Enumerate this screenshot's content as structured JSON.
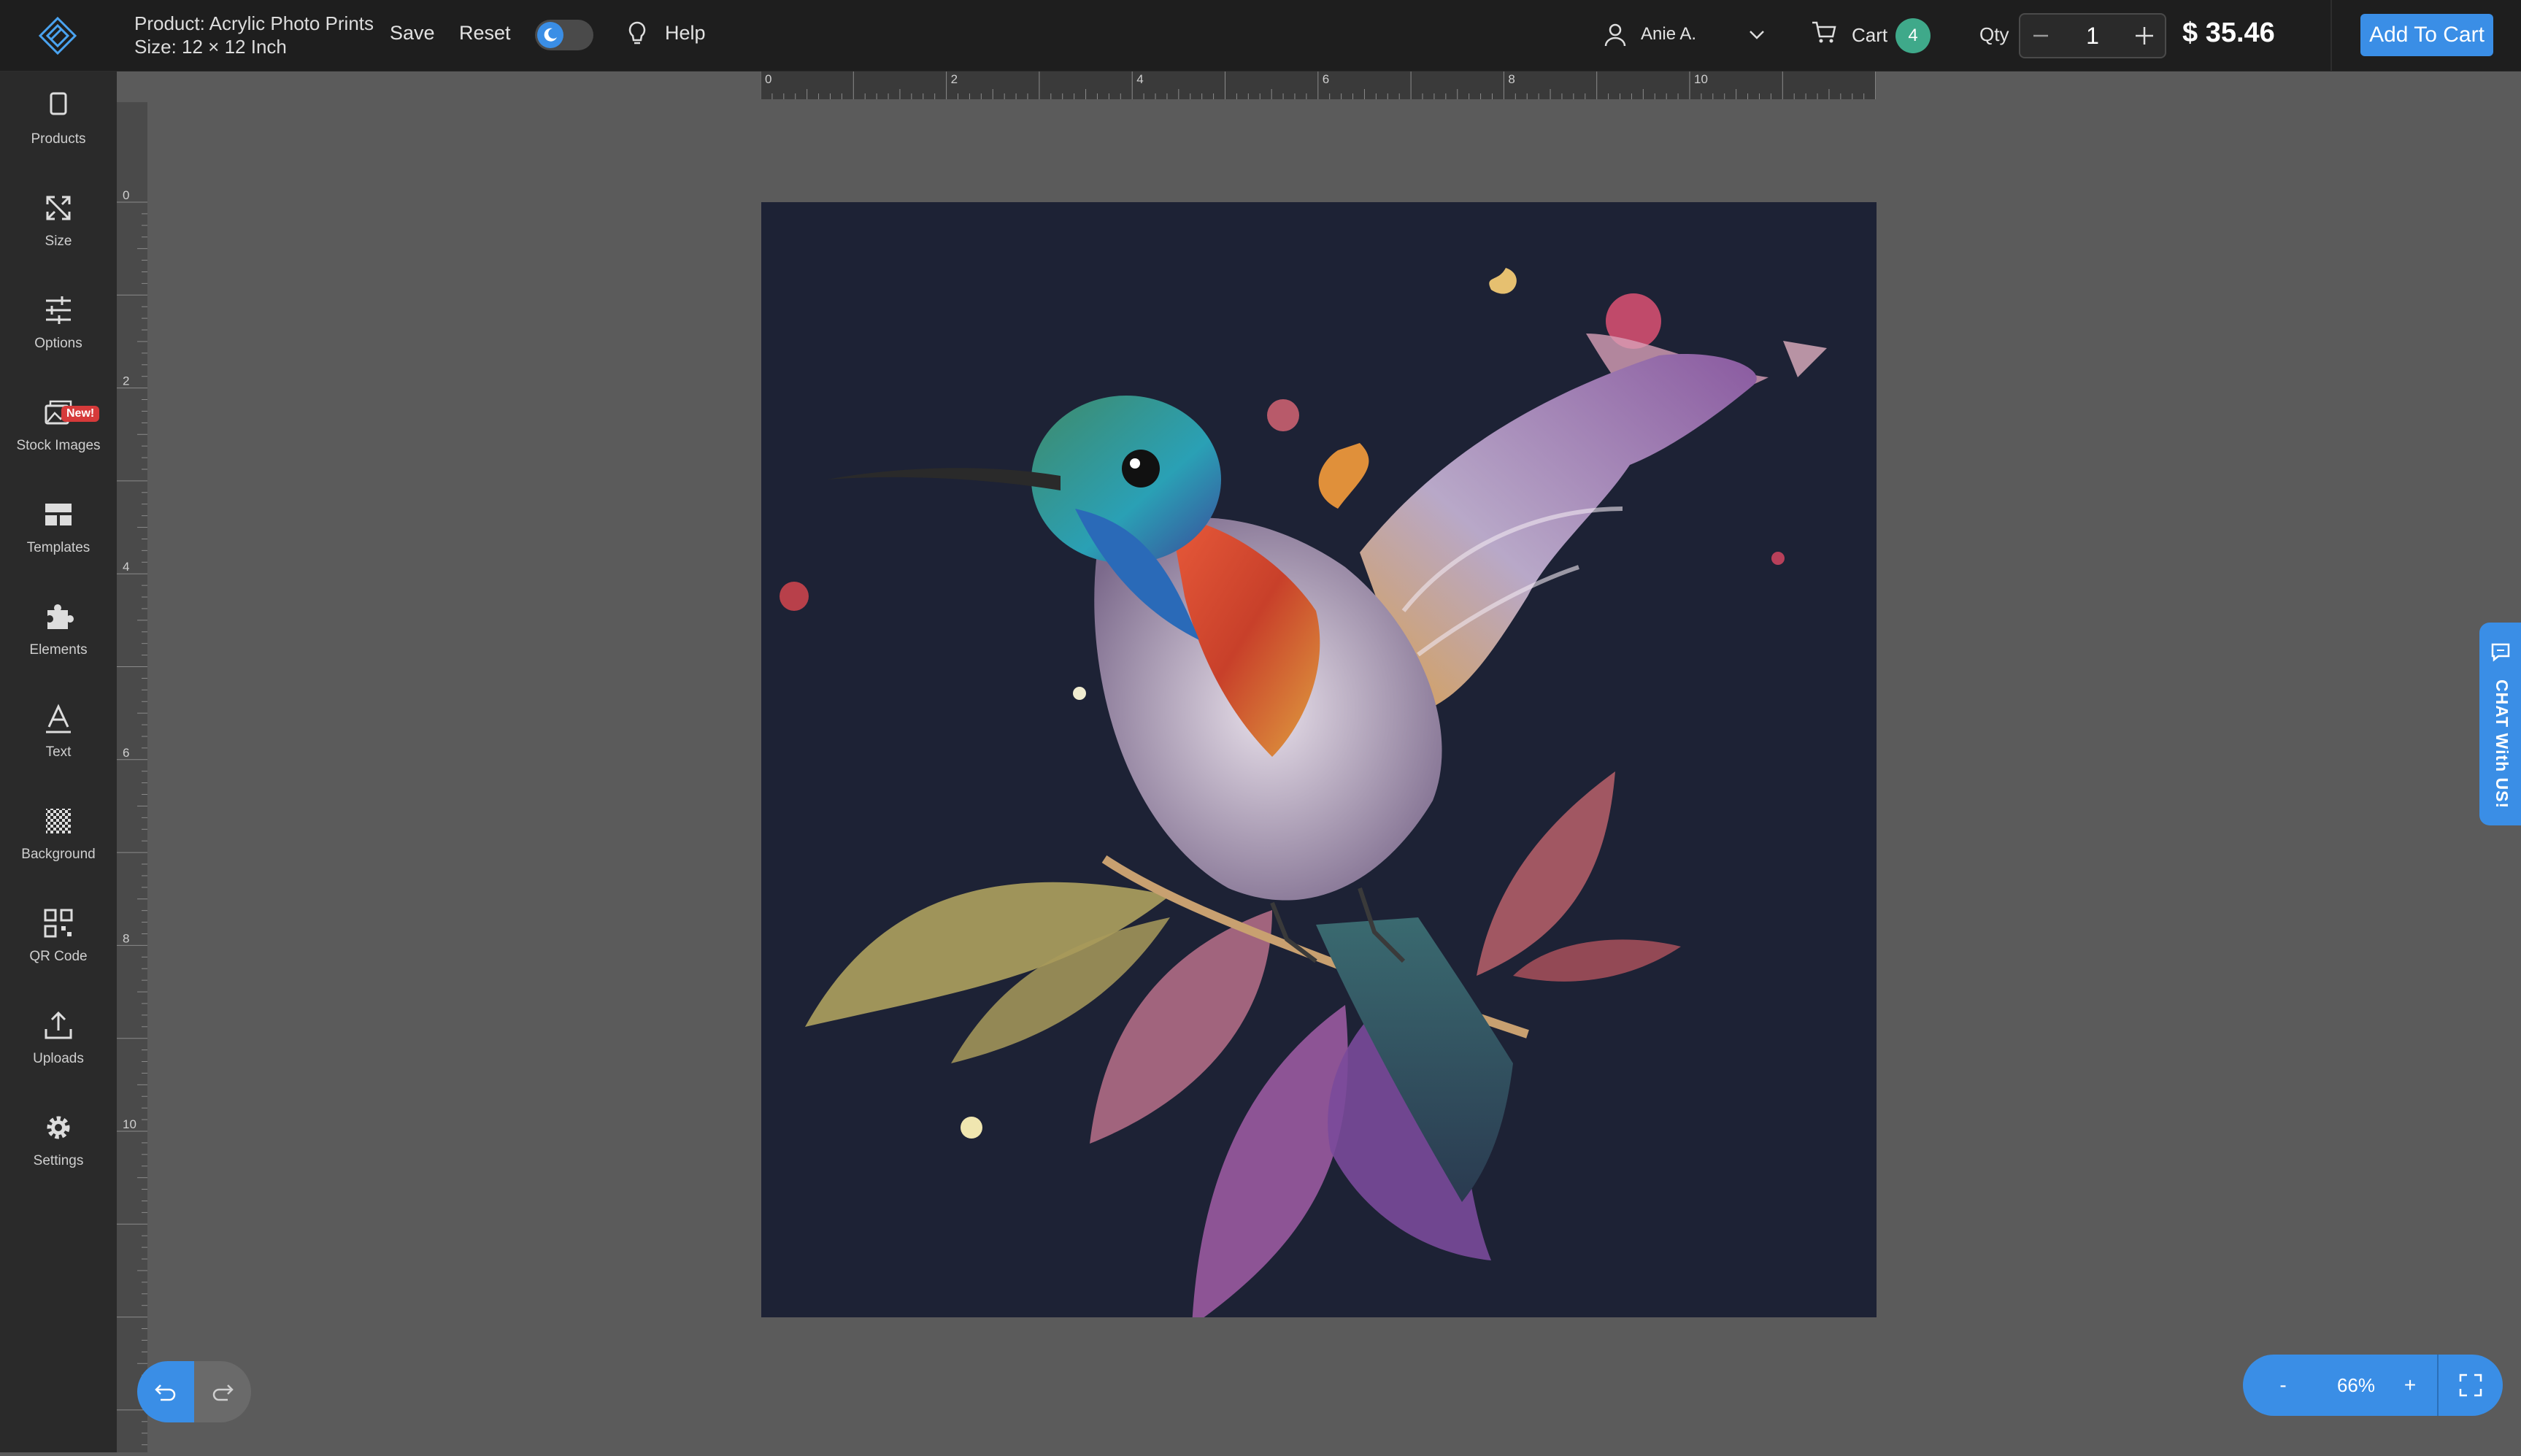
{
  "header": {
    "product_label": "Product: Acrylic Photo Prints",
    "size_label": "Size: 12 × 12 Inch",
    "save_label": "Save",
    "reset_label": "Reset",
    "help_label": "Help",
    "user_name": "Anie A.",
    "cart_label": "Cart",
    "cart_count": "4",
    "qty_label": "Qty",
    "qty_value": "1",
    "price": "$ 35.46",
    "add_to_cart_label": "Add To Cart"
  },
  "sidebar": {
    "items": [
      {
        "label": "Products",
        "icon": "tablet-icon"
      },
      {
        "label": "Size",
        "icon": "resize-arrows-icon"
      },
      {
        "label": "Options",
        "icon": "sliders-icon"
      },
      {
        "label": "Stock Images",
        "icon": "images-icon",
        "badge": "New!"
      },
      {
        "label": "Templates",
        "icon": "template-icon"
      },
      {
        "label": "Elements",
        "icon": "puzzle-icon"
      },
      {
        "label": "Text",
        "icon": "text-icon"
      },
      {
        "label": "Background",
        "icon": "checker-icon"
      },
      {
        "label": "QR Code",
        "icon": "qr-icon"
      },
      {
        "label": "Uploads",
        "icon": "upload-icon"
      },
      {
        "label": "Settings",
        "icon": "gear-icon"
      }
    ]
  },
  "ruler": {
    "top_labels": [
      "0",
      "2",
      "4",
      "6",
      "8",
      "10"
    ],
    "left_labels": [
      "0",
      "2",
      "4",
      "6",
      "8",
      "10"
    ]
  },
  "chat": {
    "label": "CHAT With US!"
  },
  "zoom": {
    "minus": "-",
    "value": "66%",
    "plus": "+"
  },
  "colors": {
    "accent": "#3a8ee6",
    "cart_badge": "#3fa98a",
    "canvas_bg": "#1d2235",
    "new_badge": "#d63a3a"
  }
}
